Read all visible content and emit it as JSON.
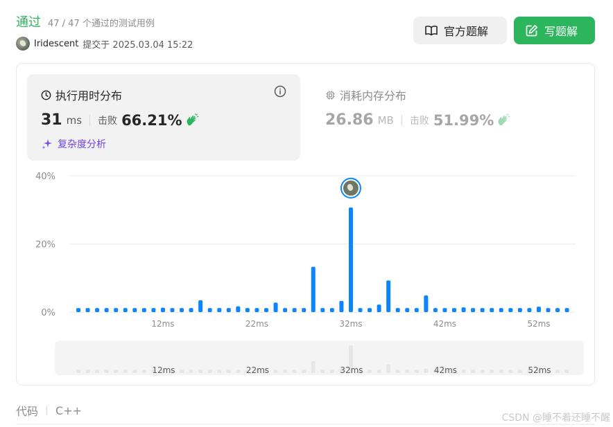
{
  "submission": {
    "status": "通过",
    "passed_cases": "47 / 47 个通过的测试用例",
    "user": "Iridescent",
    "submitted_text": "提交于 2025.03.04 15:22"
  },
  "actions": {
    "official_solution": "官方题解",
    "write_solution": "写题解"
  },
  "runtime": {
    "title": "执行用时分布",
    "value": "31",
    "unit": "ms",
    "beats_label": "击败",
    "beats_value": "66.21%",
    "analysis": "复杂度分析"
  },
  "memory": {
    "title": "消耗内存分布",
    "value": "26.86",
    "unit": "MB",
    "beats_label": "击败",
    "beats_value": "51.99%"
  },
  "code": {
    "label": "代码",
    "language": "C++"
  },
  "watermark": "CSDN @睡不着还睡不醒",
  "chart_data": [
    {
      "type": "bar",
      "name": "执行用时分布",
      "ylabel": "",
      "xlabel": "",
      "ylim": [
        0,
        40
      ],
      "yticks": [
        "0%",
        "20%",
        "40%"
      ],
      "xtick_labels": [
        "12ms",
        "22ms",
        "32ms",
        "42ms",
        "52ms"
      ],
      "xtick_values": [
        12,
        22,
        32,
        42,
        52
      ],
      "x_unit": "ms",
      "categories": [
        3,
        4,
        5,
        6,
        7,
        8,
        9,
        10,
        11,
        12,
        13,
        14,
        15,
        16,
        17,
        18,
        19,
        20,
        21,
        22,
        23,
        24,
        25,
        26,
        27,
        28,
        29,
        30,
        31,
        32,
        33,
        34,
        35,
        36,
        37,
        38,
        39,
        40,
        41,
        42,
        43,
        44,
        45,
        46,
        47,
        48,
        49,
        50,
        51,
        52,
        53,
        54,
        55
      ],
      "values": [
        1.2,
        1.2,
        1.2,
        1.2,
        1.2,
        1.2,
        1.2,
        1.2,
        1.2,
        1.3,
        1.2,
        1.2,
        1.2,
        3.5,
        1.2,
        1.2,
        1.2,
        1.7,
        1.2,
        1.2,
        1.2,
        2.8,
        1.2,
        1.2,
        1.2,
        13.3,
        1.2,
        1.2,
        3.3,
        30.7,
        1.2,
        1.2,
        2.2,
        9.3,
        1.2,
        1.2,
        1.2,
        4.9,
        1.2,
        1.2,
        1.2,
        1.4,
        1.2,
        1.2,
        1.2,
        1.2,
        1.2,
        1.2,
        1.2,
        1.6,
        1.2,
        1.2,
        1.2
      ],
      "highlight_x": 32,
      "colors": {
        "bar": "#0a84ff",
        "nav_bar": "#e6e6e6",
        "grid": "#ebebeb"
      },
      "grid": true,
      "legend": "none"
    }
  ]
}
